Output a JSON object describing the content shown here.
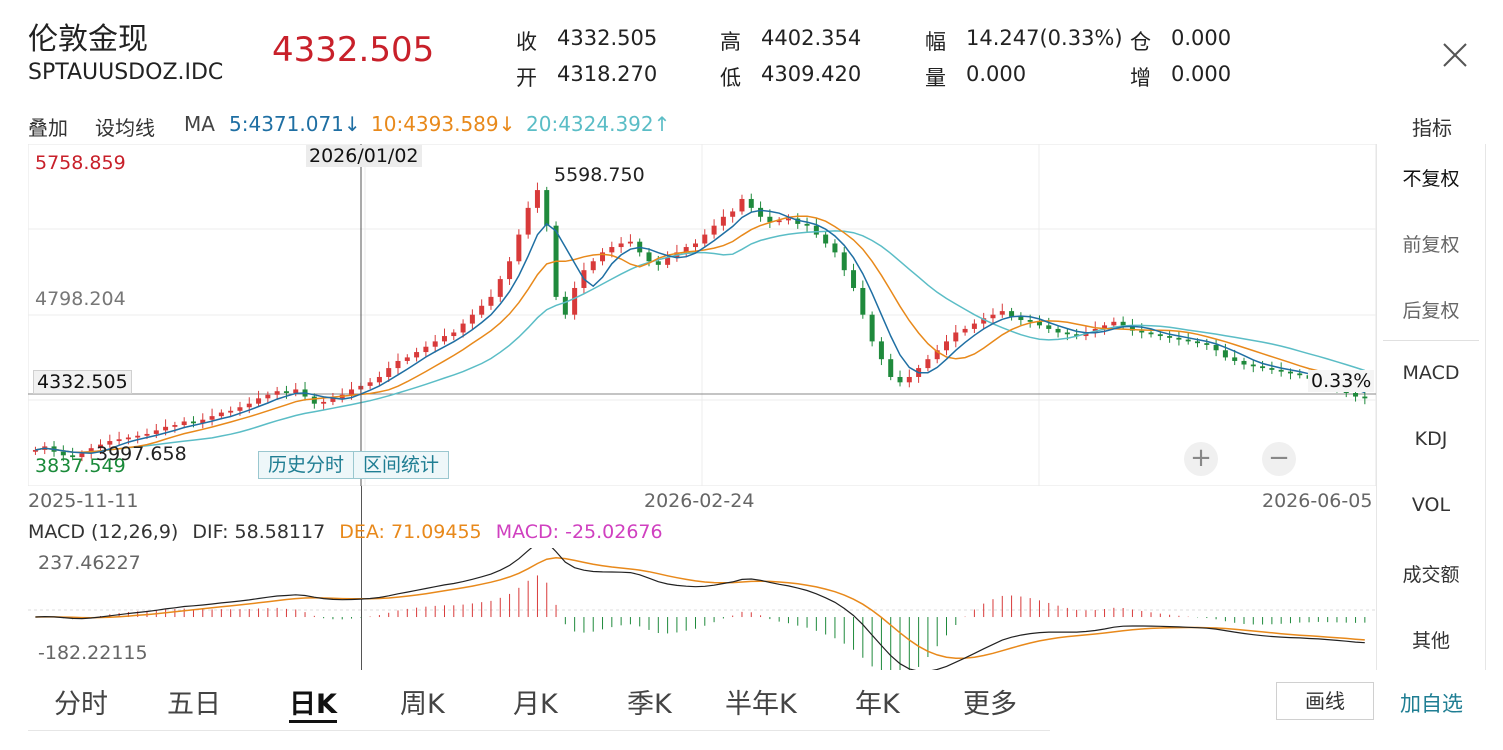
{
  "header": {
    "name": "伦敦金现",
    "code": "SPTAUUSDOZ.IDC",
    "price": "4332.505",
    "quote": [
      {
        "label": "收",
        "value": "4332.505"
      },
      {
        "label": "开",
        "value": "4318.270"
      },
      {
        "label": "高",
        "value": "4402.354"
      },
      {
        "label": "低",
        "value": "4309.420"
      },
      {
        "label": "幅",
        "value": "14.247(0.33%)"
      },
      {
        "label": "量",
        "value": "0.000"
      },
      {
        "label": "仓",
        "value": "0.000"
      },
      {
        "label": "增",
        "value": "0.000"
      }
    ]
  },
  "toolbar": {
    "overlay": "叠加",
    "set_ma": "设均线",
    "ma_label": "MA",
    "ma5": "5:4371.071↓",
    "ma10": "10:4393.589↓",
    "ma20": "20:4324.392↑",
    "indicator": "指标"
  },
  "chart": {
    "y_top": "5758.859",
    "y_mid": "4798.204",
    "y_bottom": "3837.549",
    "current_price": "4332.505",
    "crosshair_date": "2026/01/02",
    "max_label": "5598.750",
    "min_label": "3997.658",
    "pct": "0.33%",
    "history_btn": "历史分时",
    "range_btn": "区间统计",
    "zoom_in": "+",
    "zoom_out": "−",
    "x_labels": [
      "2025-11-11",
      "2026-02-24",
      "2026-06-05"
    ]
  },
  "macd": {
    "title": "MACD (12,26,9)",
    "dif": "DIF: 58.58117",
    "dea": "DEA: 71.09455",
    "macd": "MACD: -25.02676",
    "y_top": "237.46227",
    "y_bottom": "-182.22115"
  },
  "right_menu": [
    "不复权",
    "前复权",
    "后复权",
    "MACD",
    "KDJ",
    "VOL",
    "成交额",
    "其他"
  ],
  "tabs": [
    "分时",
    "五日",
    "日K",
    "周K",
    "月K",
    "季K",
    "半年K",
    "年K",
    "更多"
  ],
  "active_tab": "日K",
  "bottom": {
    "draw": "画线",
    "add_fav": "加自选"
  },
  "colors": {
    "up": "#d83a3a",
    "down": "#1f8a3c",
    "ma5": "#1f6fa3",
    "ma10": "#e8891b",
    "ma20": "#5bbdc6",
    "dea": "#e8891b",
    "macd": "#d040c0"
  },
  "chart_data": {
    "type": "candlestick",
    "x_range": [
      "2025-11-11",
      "2026-06-05"
    ],
    "ylim": [
      3837.549,
      5758.859
    ],
    "max": 5598.75,
    "min": 3997.658,
    "last": 4332.505,
    "close_series": [
      4040,
      4060,
      4030,
      4010,
      4000,
      4020,
      4050,
      4070,
      4090,
      4100,
      4110,
      4120,
      4130,
      4150,
      4170,
      4180,
      4200,
      4190,
      4210,
      4230,
      4250,
      4260,
      4280,
      4300,
      4330,
      4350,
      4370,
      4360,
      4380,
      4340,
      4300,
      4310,
      4330,
      4350,
      4380,
      4400,
      4420,
      4450,
      4500,
      4540,
      4560,
      4590,
      4620,
      4650,
      4680,
      4700,
      4750,
      4800,
      4850,
      4900,
      5000,
      5100,
      5250,
      5400,
      5500,
      5300,
      4900,
      4800,
      4950,
      5050,
      5100,
      5150,
      5180,
      5200,
      5210,
      5150,
      5100,
      5080,
      5120,
      5150,
      5180,
      5200,
      5250,
      5300,
      5350,
      5380,
      5450,
      5400,
      5350,
      5320,
      5330,
      5340,
      5310,
      5300,
      5250,
      5200,
      5150,
      5050,
      4950,
      4800,
      4650,
      4550,
      4450,
      4420,
      4450,
      4500,
      4550,
      4600,
      4650,
      4700,
      4720,
      4750,
      4780,
      4800,
      4820,
      4790,
      4770,
      4760,
      4740,
      4720,
      4700,
      4690,
      4680,
      4700,
      4720,
      4740,
      4760,
      4740,
      4710,
      4700,
      4690,
      4680,
      4670,
      4660,
      4650,
      4640,
      4630,
      4600,
      4560,
      4540,
      4520,
      4510,
      4500,
      4490,
      4480,
      4470,
      4460,
      4440,
      4430,
      4400,
      4380,
      4360,
      4340,
      4330
    ],
    "macd_range": [
      -182.22115,
      237.46227
    ]
  }
}
